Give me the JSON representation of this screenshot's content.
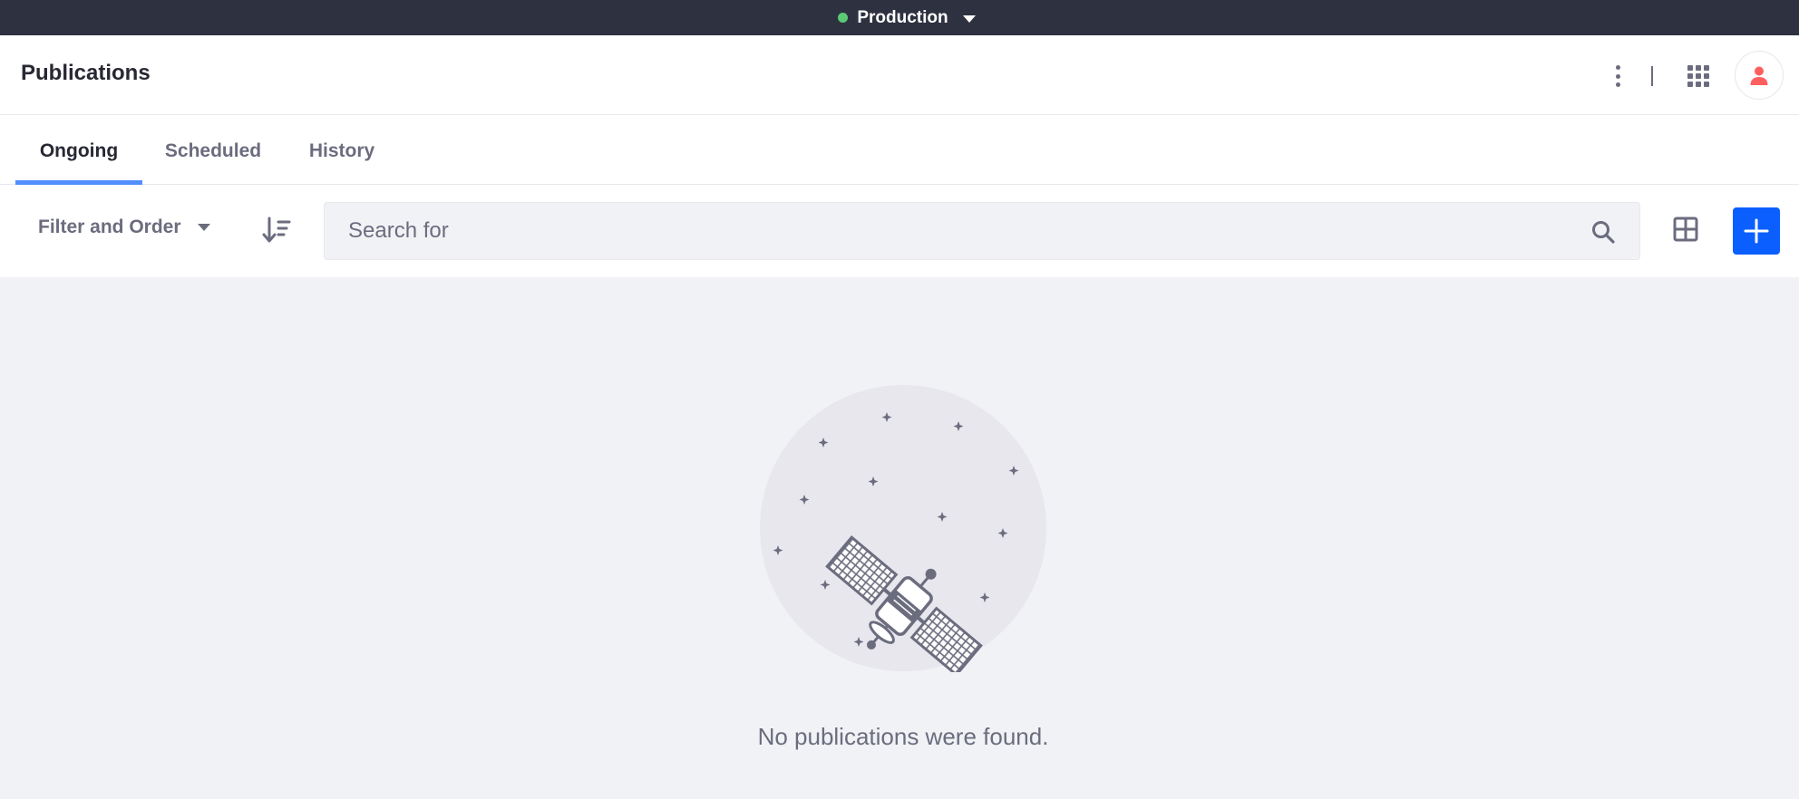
{
  "environment": {
    "name": "Production",
    "status_color": "#5aca75"
  },
  "header": {
    "title": "Publications",
    "icons": [
      "options-vertical-icon",
      "apps-grid-icon",
      "user-avatar-icon"
    ]
  },
  "tabs": [
    {
      "label": "Ongoing",
      "active": true
    },
    {
      "label": "Scheduled",
      "active": false
    },
    {
      "label": "History",
      "active": false
    }
  ],
  "toolbar": {
    "filter_label": "Filter and Order",
    "sort_icon": "order-arrow-down-icon",
    "search": {
      "placeholder": "Search for",
      "value": ""
    },
    "view_icon": "cards-view-icon",
    "add_icon": "plus-icon"
  },
  "empty_state": {
    "illustration": "satellite-icon",
    "message": "No publications were found."
  },
  "colors": {
    "accent": "#0b5fff",
    "tab_indicator": "#528eff",
    "top_bar": "#2e3140",
    "avatar": "#ff5f5f"
  }
}
